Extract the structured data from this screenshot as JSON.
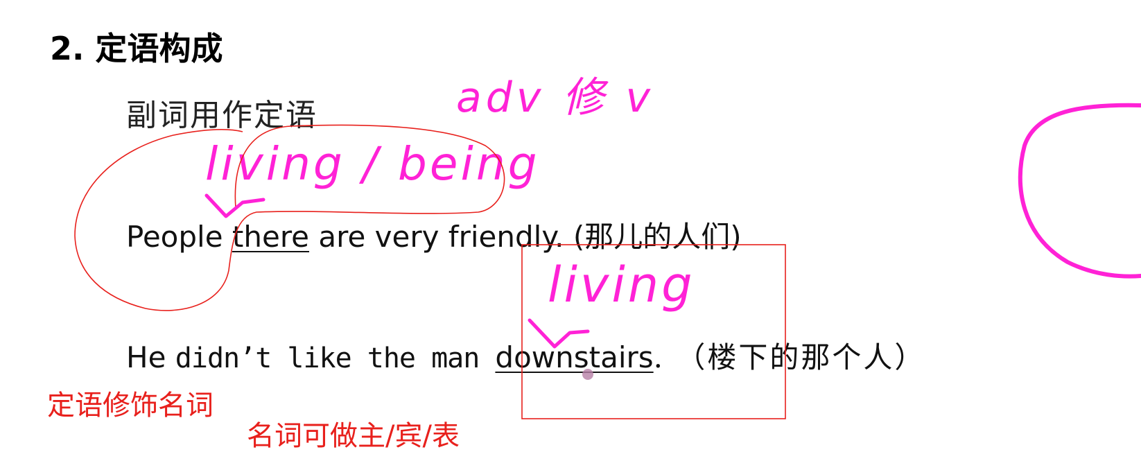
{
  "heading": "2. 定语构成",
  "subheading": "副词用作定语",
  "sentence1": {
    "before": "People ",
    "underlined": "there",
    "after": " are very friendly. (那儿的人们)"
  },
  "sentence2": {
    "part_he": "He ",
    "part_mono": "didn’t like the man ",
    "underlined": "downstairs",
    "after": ". （楼下的那个人）"
  },
  "annotations_handwritten": {
    "adv_note": "adv 修 v",
    "living_being": "living / being",
    "living": "living"
  },
  "annotations_typed": {
    "note1": "定语修饰名词",
    "note2": "名词可做主/宾/表"
  },
  "colors": {
    "handwriting": "#ff22d6",
    "typed_notes": "#e8201c",
    "text": "#111111"
  }
}
